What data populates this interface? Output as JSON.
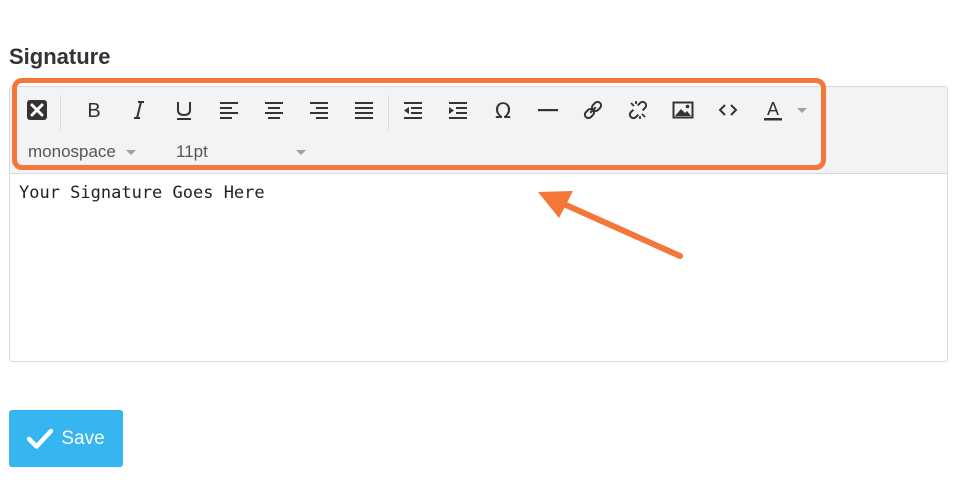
{
  "section": {
    "title": "Signature"
  },
  "toolbar": {
    "buttons": [
      {
        "name": "clear-formatting",
        "icon": "close-box-icon"
      },
      {
        "name": "bold",
        "icon": "bold-icon"
      },
      {
        "name": "italic",
        "icon": "italic-icon"
      },
      {
        "name": "underline",
        "icon": "underline-icon"
      },
      {
        "name": "align-left",
        "icon": "align-left-icon"
      },
      {
        "name": "align-center",
        "icon": "align-center-icon"
      },
      {
        "name": "align-right",
        "icon": "align-right-icon"
      },
      {
        "name": "align-justify",
        "icon": "align-justify-icon"
      },
      {
        "name": "outdent",
        "icon": "outdent-icon"
      },
      {
        "name": "indent",
        "icon": "indent-icon"
      },
      {
        "name": "special-character",
        "icon": "omega-icon"
      },
      {
        "name": "horizontal-line",
        "icon": "horizontal-line-icon"
      },
      {
        "name": "insert-link",
        "icon": "link-icon"
      },
      {
        "name": "remove-link",
        "icon": "unlink-icon"
      },
      {
        "name": "insert-image",
        "icon": "image-icon"
      },
      {
        "name": "source-code",
        "icon": "code-icon"
      },
      {
        "name": "text-color",
        "icon": "text-color-icon"
      }
    ],
    "font_family": "monospace",
    "font_size": "11pt"
  },
  "editor": {
    "content": "Your Signature Goes Here"
  },
  "save_button": {
    "label": "Save",
    "icon": "checkmark-icon"
  },
  "colors": {
    "accent": "#35b6f1",
    "highlight": "#f4773a"
  }
}
